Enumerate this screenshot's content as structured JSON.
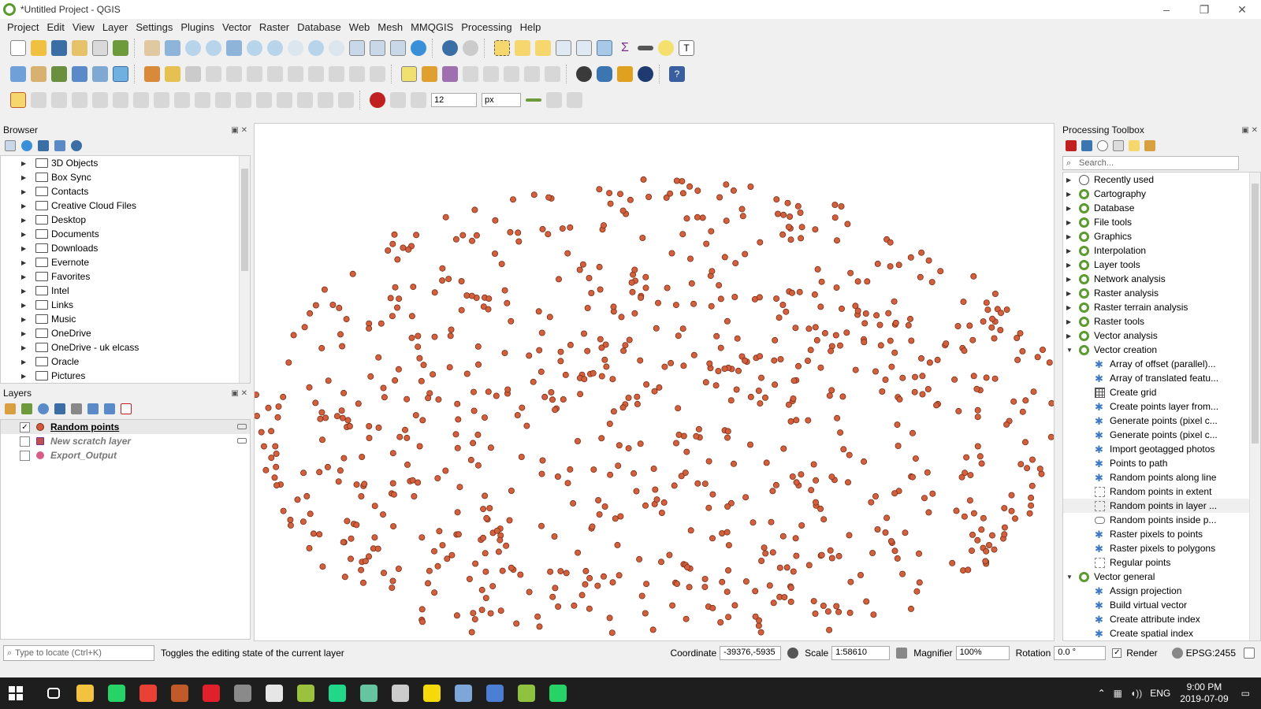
{
  "window": {
    "title": "*Untitled Project - QGIS",
    "controls": [
      "–",
      "❐",
      "✕"
    ]
  },
  "menu": [
    "Project",
    "Edit",
    "View",
    "Layer",
    "Settings",
    "Plugins",
    "Vector",
    "Raster",
    "Database",
    "Web",
    "Mesh",
    "MMQGIS",
    "Processing",
    "Help"
  ],
  "toolbar3": {
    "size_value": "12",
    "size_unit": "px"
  },
  "browser": {
    "title": "Browser",
    "items": [
      "3D Objects",
      "Box Sync",
      "Contacts",
      "Creative Cloud Files",
      "Desktop",
      "Documents",
      "Downloads",
      "Evernote",
      "Favorites",
      "Intel",
      "Links",
      "Music",
      "OneDrive",
      "OneDrive - uk elcass",
      "Oracle",
      "Pictures"
    ]
  },
  "layers": {
    "title": "Layers",
    "rows": [
      {
        "name": "Random points",
        "checked": true,
        "color": "#d25a3c",
        "style": "bold-underline"
      },
      {
        "name": "New scratch layer",
        "checked": false,
        "color": "#c0504d",
        "style": "italic"
      },
      {
        "name": "Export_Output",
        "checked": false,
        "color": "#d85c8a",
        "style": "italic"
      }
    ]
  },
  "map": {
    "point_color": "#d2603e",
    "point_stroke": "#7a2e14"
  },
  "toolbox": {
    "title": "Processing Toolbox",
    "search_placeholder": "Search...",
    "groups": [
      {
        "label": "Recently used",
        "icon": "clock",
        "expanded": false
      },
      {
        "label": "Cartography",
        "icon": "qgis",
        "expanded": false
      },
      {
        "label": "Database",
        "icon": "qgis",
        "expanded": false
      },
      {
        "label": "File tools",
        "icon": "qgis",
        "expanded": false
      },
      {
        "label": "Graphics",
        "icon": "qgis",
        "expanded": false
      },
      {
        "label": "Interpolation",
        "icon": "qgis",
        "expanded": false
      },
      {
        "label": "Layer tools",
        "icon": "qgis",
        "expanded": false
      },
      {
        "label": "Network analysis",
        "icon": "qgis",
        "expanded": false
      },
      {
        "label": "Raster analysis",
        "icon": "qgis",
        "expanded": false
      },
      {
        "label": "Raster terrain analysis",
        "icon": "qgis",
        "expanded": false
      },
      {
        "label": "Raster tools",
        "icon": "qgis",
        "expanded": false
      },
      {
        "label": "Vector analysis",
        "icon": "qgis",
        "expanded": false
      },
      {
        "label": "Vector creation",
        "icon": "qgis",
        "expanded": true,
        "children": [
          {
            "label": "Array of offset (parallel)...",
            "icon": "gear"
          },
          {
            "label": "Array of translated featu...",
            "icon": "gear"
          },
          {
            "label": "Create grid",
            "icon": "grid"
          },
          {
            "label": "Create points layer from...",
            "icon": "gear"
          },
          {
            "label": "Generate points (pixel c...",
            "icon": "gear"
          },
          {
            "label": "Generate points (pixel c...",
            "icon": "gear"
          },
          {
            "label": "Import geotagged photos",
            "icon": "gear"
          },
          {
            "label": "Points to path",
            "icon": "gear"
          },
          {
            "label": "Random points along line",
            "icon": "gear"
          },
          {
            "label": "Random points in extent",
            "icon": "dots"
          },
          {
            "label": "Random points in layer ...",
            "icon": "dots",
            "selected": true
          },
          {
            "label": "Random points inside p...",
            "icon": "ovl"
          },
          {
            "label": "Raster pixels to points",
            "icon": "gear"
          },
          {
            "label": "Raster pixels to polygons",
            "icon": "gear"
          },
          {
            "label": "Regular points",
            "icon": "dots"
          }
        ]
      },
      {
        "label": "Vector general",
        "icon": "qgis",
        "expanded": true,
        "children": [
          {
            "label": "Assign projection",
            "icon": "gear"
          },
          {
            "label": "Build virtual vector",
            "icon": "gear"
          },
          {
            "label": "Create attribute index",
            "icon": "gear"
          },
          {
            "label": "Create spatial index",
            "icon": "gear"
          }
        ]
      }
    ]
  },
  "status": {
    "locate_placeholder": "Type to locate (Ctrl+K)",
    "message": "Toggles the editing state of the current layer",
    "coordinate_label": "Coordinate",
    "coordinate_value": "-39376,-5935",
    "scale_label": "Scale",
    "scale_value": "1:58610",
    "magnifier_label": "Magnifier",
    "magnifier_value": "100%",
    "rotation_label": "Rotation",
    "rotation_value": "0.0 °",
    "render_label": "Render",
    "crs": "EPSG:2455"
  },
  "taskbar": {
    "time": "9:00 PM",
    "date": "2019-07-09",
    "lang": "ENG",
    "apps": [
      {
        "name": "task-view",
        "color": "#ffffff"
      },
      {
        "name": "file-explorer",
        "color": "#f3c33f"
      },
      {
        "name": "whatsapp",
        "color": "#25d366"
      },
      {
        "name": "chrome",
        "color": "#e94235"
      },
      {
        "name": "winrar",
        "color": "#c05a28"
      },
      {
        "name": "opera",
        "color": "#e0202a"
      },
      {
        "name": "sas",
        "color": "#8a8a8a"
      },
      {
        "name": "mail",
        "color": "#e6e6e6"
      },
      {
        "name": "mendeley",
        "color": "#9ac23c"
      },
      {
        "name": "pycharm",
        "color": "#21d789"
      },
      {
        "name": "atom",
        "color": "#66c5a0"
      },
      {
        "name": "obs",
        "color": "#cccccc"
      },
      {
        "name": "sticky-notes",
        "color": "#f5d90a"
      },
      {
        "name": "virtualbox",
        "color": "#7da7d9"
      },
      {
        "name": "browser",
        "color": "#4a7fd4"
      },
      {
        "name": "qgis",
        "color": "#8fc33f"
      },
      {
        "name": "whatsapp-2",
        "color": "#25d366"
      }
    ]
  }
}
